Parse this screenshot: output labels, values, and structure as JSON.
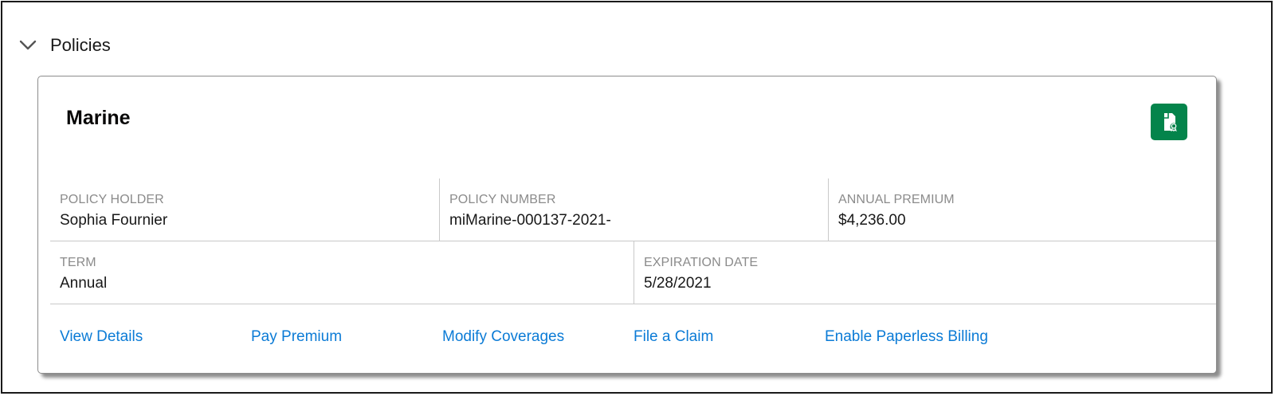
{
  "section": {
    "title": "Policies",
    "toggle_icon": "chevron-down-icon"
  },
  "card": {
    "title": "Marine",
    "icon": "policy-document-icon",
    "icon_color": "#04844b",
    "fields_row1": [
      {
        "label": "POLICY HOLDER",
        "value": "Sophia Fournier"
      },
      {
        "label": "POLICY NUMBER",
        "value": "miMarine-000137-2021-"
      },
      {
        "label": "ANNUAL PREMIUM",
        "value": "$4,236.00"
      }
    ],
    "fields_row2": [
      {
        "label": "TERM",
        "value": "Annual"
      },
      {
        "label": "EXPIRATION DATE",
        "value": "5/28/2021"
      }
    ],
    "actions": [
      "View Details",
      "Pay Premium",
      "Modify Coverages",
      "File a Claim",
      "Enable Paperless Billing"
    ]
  },
  "colors": {
    "link": "#0b7bd6",
    "label": "#8b8b8b",
    "divider": "#c9c9c9"
  }
}
